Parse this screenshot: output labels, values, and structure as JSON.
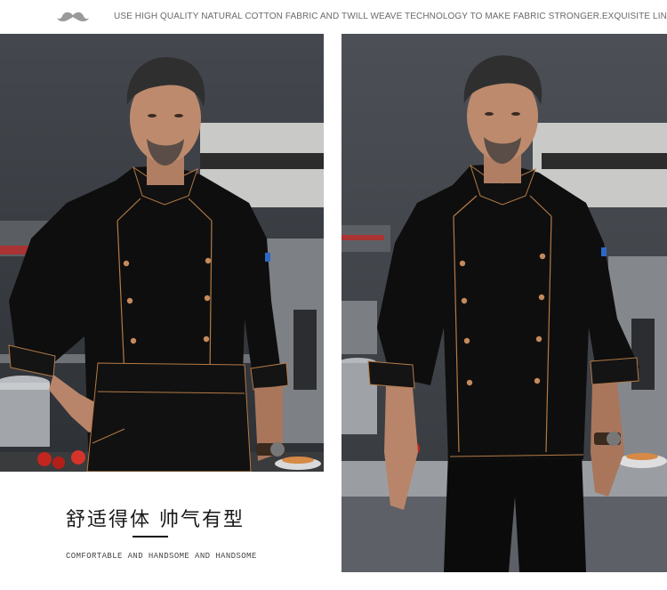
{
  "header": {
    "tagline": "USE HIGH QUALITY NATURAL COTTON FABRIC AND TWILL WEAVE TECHNOLOGY TO MAKE FABRIC STRONGER.EXQUISITE LINE.",
    "mustache_icon": "mustache-icon"
  },
  "caption": {
    "title_cn": "舒适得体  帅气有型",
    "subtitle_en": "COMFORTABLE AND HANDSOME AND HANDSOME"
  },
  "colors": {
    "jacket": "#0d0d0d",
    "piping": "#b47a45",
    "button": "#c58a5c",
    "kitchen_bg": "#4b4f55",
    "steel": "#9a9ea3",
    "skin": "#b8856a",
    "hair": "#2f2f2f"
  }
}
